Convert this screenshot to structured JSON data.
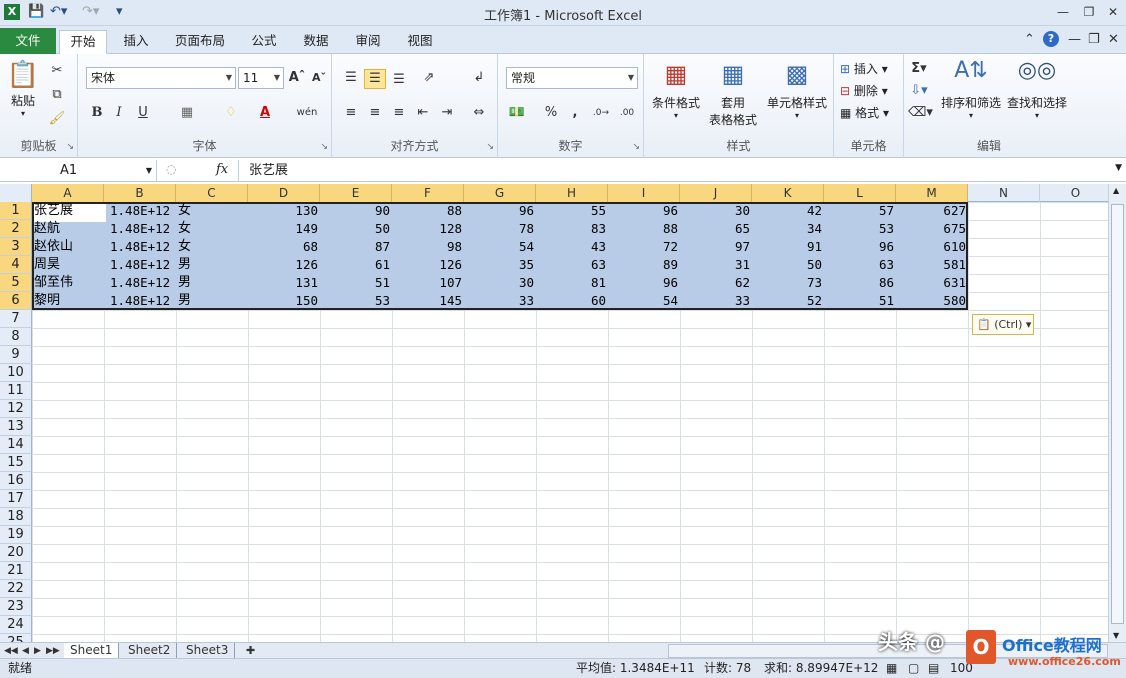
{
  "window": {
    "title": "工作簿1 - Microsoft Excel"
  },
  "quick_access": [
    "save-icon",
    "undo-icon",
    "redo-icon",
    "customize-icon"
  ],
  "tabs": [
    {
      "label": "文件"
    },
    {
      "label": "开始"
    },
    {
      "label": "插入"
    },
    {
      "label": "页面布局"
    },
    {
      "label": "公式"
    },
    {
      "label": "数据"
    },
    {
      "label": "审阅"
    },
    {
      "label": "视图"
    }
  ],
  "ribbon": {
    "clipboard": {
      "label": "剪贴板",
      "paste": "粘贴"
    },
    "font": {
      "label": "字体",
      "name": "宋体",
      "size": "11"
    },
    "alignment": {
      "label": "对齐方式"
    },
    "number": {
      "label": "数字",
      "format": "常规"
    },
    "styles": {
      "label": "样式",
      "conditional": "条件格式",
      "table_line1": "套用",
      "table_line2": "表格格式",
      "cell_styles": "单元格样式"
    },
    "cells": {
      "label": "单元格",
      "insert": "插入",
      "delete": "删除",
      "format": "格式"
    },
    "editing": {
      "label": "编辑",
      "sort": "排序和筛选",
      "find": "查找和选择"
    }
  },
  "formula_bar": {
    "name_box": "A1",
    "fx": "fx",
    "value": "张艺展"
  },
  "columns": [
    "A",
    "B",
    "C",
    "D",
    "E",
    "F",
    "G",
    "H",
    "I",
    "J",
    "K",
    "L",
    "M",
    "N",
    "O"
  ],
  "rows": [
    "1",
    "2",
    "3",
    "4",
    "5",
    "6",
    "7",
    "8",
    "9",
    "10",
    "11",
    "12",
    "13",
    "14",
    "15",
    "16",
    "17",
    "18",
    "19",
    "20",
    "21",
    "22",
    "23",
    "24",
    "25"
  ],
  "table": [
    [
      "张艺展",
      "1.48E+12",
      "女",
      "130",
      "90",
      "88",
      "96",
      "55",
      "96",
      "30",
      "42",
      "57",
      "627"
    ],
    [
      "赵航",
      "1.48E+12",
      "女",
      "149",
      "50",
      "128",
      "78",
      "83",
      "88",
      "65",
      "34",
      "53",
      "675"
    ],
    [
      "赵依山",
      "1.48E+12",
      "女",
      "68",
      "87",
      "98",
      "54",
      "43",
      "72",
      "97",
      "91",
      "96",
      "610"
    ],
    [
      "周昊",
      "1.48E+12",
      "男",
      "126",
      "61",
      "126",
      "35",
      "63",
      "89",
      "31",
      "50",
      "63",
      "581"
    ],
    [
      "邹至伟",
      "1.48E+12",
      "男",
      "131",
      "51",
      "107",
      "30",
      "81",
      "96",
      "62",
      "73",
      "86",
      "631"
    ],
    [
      "黎明",
      "1.48E+12",
      "男",
      "150",
      "53",
      "145",
      "33",
      "60",
      "54",
      "33",
      "52",
      "51",
      "580"
    ]
  ],
  "paste_options": "(Ctrl)",
  "sheets": [
    "Sheet1",
    "Sheet2",
    "Sheet3"
  ],
  "status": {
    "ready": "就绪",
    "average": "平均值: 1.3484E+11",
    "count": "计数: 78",
    "sum": "求和: 8.89947E+12",
    "zoom": "100"
  },
  "watermark": {
    "text": "头条 @",
    "site": "Office教程网",
    "url": "www.office26.com"
  }
}
